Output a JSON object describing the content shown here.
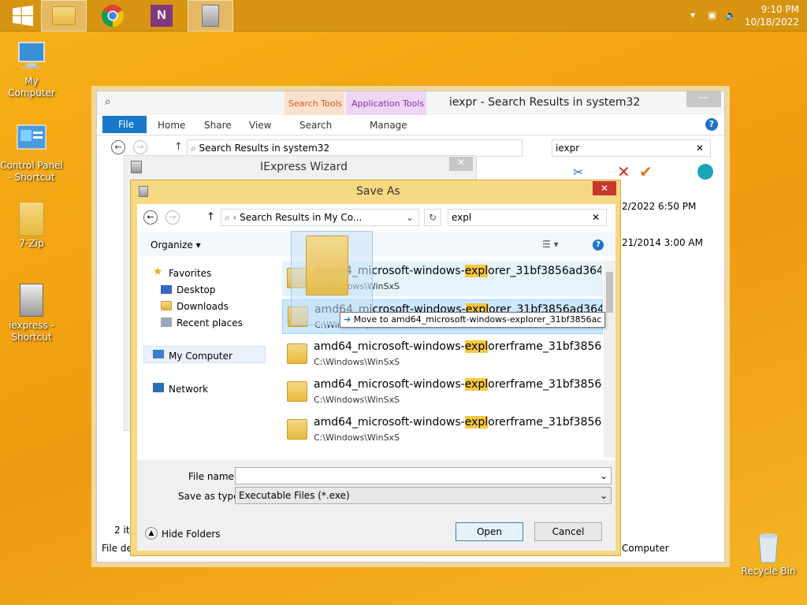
{
  "taskbar": {
    "time": "9:10 PM",
    "date": "10/18/2022",
    "apps": [
      "file-explorer",
      "chrome",
      "onenote",
      "iexpress"
    ]
  },
  "desktop": {
    "icons": [
      {
        "label": "My Computer"
      },
      {
        "label": "Control Panel - Shortcut"
      },
      {
        "label": "7-Zip"
      },
      {
        "label": "iexpress - Shortcut"
      },
      {
        "label": "Recycle Bin"
      }
    ]
  },
  "explorer": {
    "title": "iexpr - Search Results in system32",
    "ctx_search": "Search Tools",
    "ctx_app": "Application Tools",
    "tabs": [
      "File",
      "Home",
      "Share",
      "View",
      "Search",
      "Manage"
    ],
    "address": "Search Results in system32",
    "search_value": "iexpr",
    "date1": "2/2022 6:50 PM",
    "date2": "21/2014 3:00 AM",
    "status_left": "2 ite",
    "status_file": "File de",
    "status_right": "Computer"
  },
  "iexpress": {
    "title": "IExpress Wizard"
  },
  "saveas": {
    "title": "Save As",
    "address": "Search Results in My Co...",
    "search_value": "expl",
    "organize": "Organize",
    "nav": {
      "favorites": "Favorites",
      "desktop": "Desktop",
      "downloads": "Downloads",
      "recent": "Recent places",
      "computer": "My Computer",
      "network": "Network"
    },
    "items": [
      {
        "pre": "amd64_microsoft-windows-",
        "hl": "expl",
        "post": "orer_31bf3856ad364...",
        "path": "C:\\Windows\\WinSxS"
      },
      {
        "pre": "amd64_microsoft-windows-",
        "hl": "expl",
        "post": "orer_31bf3856ad364...",
        "path": "C:\\Windows\\WinSxS"
      },
      {
        "pre": "amd64_microsoft-windows-",
        "hl": "expl",
        "post": "orerframe_31bf3856a...",
        "path": "C:\\Windows\\WinSxS"
      },
      {
        "pre": "amd64_microsoft-windows-",
        "hl": "expl",
        "post": "orerframe_31bf3856a...",
        "path": "C:\\Windows\\WinSxS"
      },
      {
        "pre": "amd64_microsoft-windows-",
        "hl": "expl",
        "post": "orerframe_31bf3856a...",
        "path": "C:\\Windows\\WinSxS"
      }
    ],
    "drag_tooltip": "Move to amd64_microsoft-windows-explorer_31bf3856ac",
    "file_name_label": "File name:",
    "file_name_value": "",
    "save_type_label": "Save as type:",
    "save_type_value": "Executable Files (*.exe)",
    "hide_folders": "Hide Folders",
    "open": "Open",
    "cancel": "Cancel"
  }
}
